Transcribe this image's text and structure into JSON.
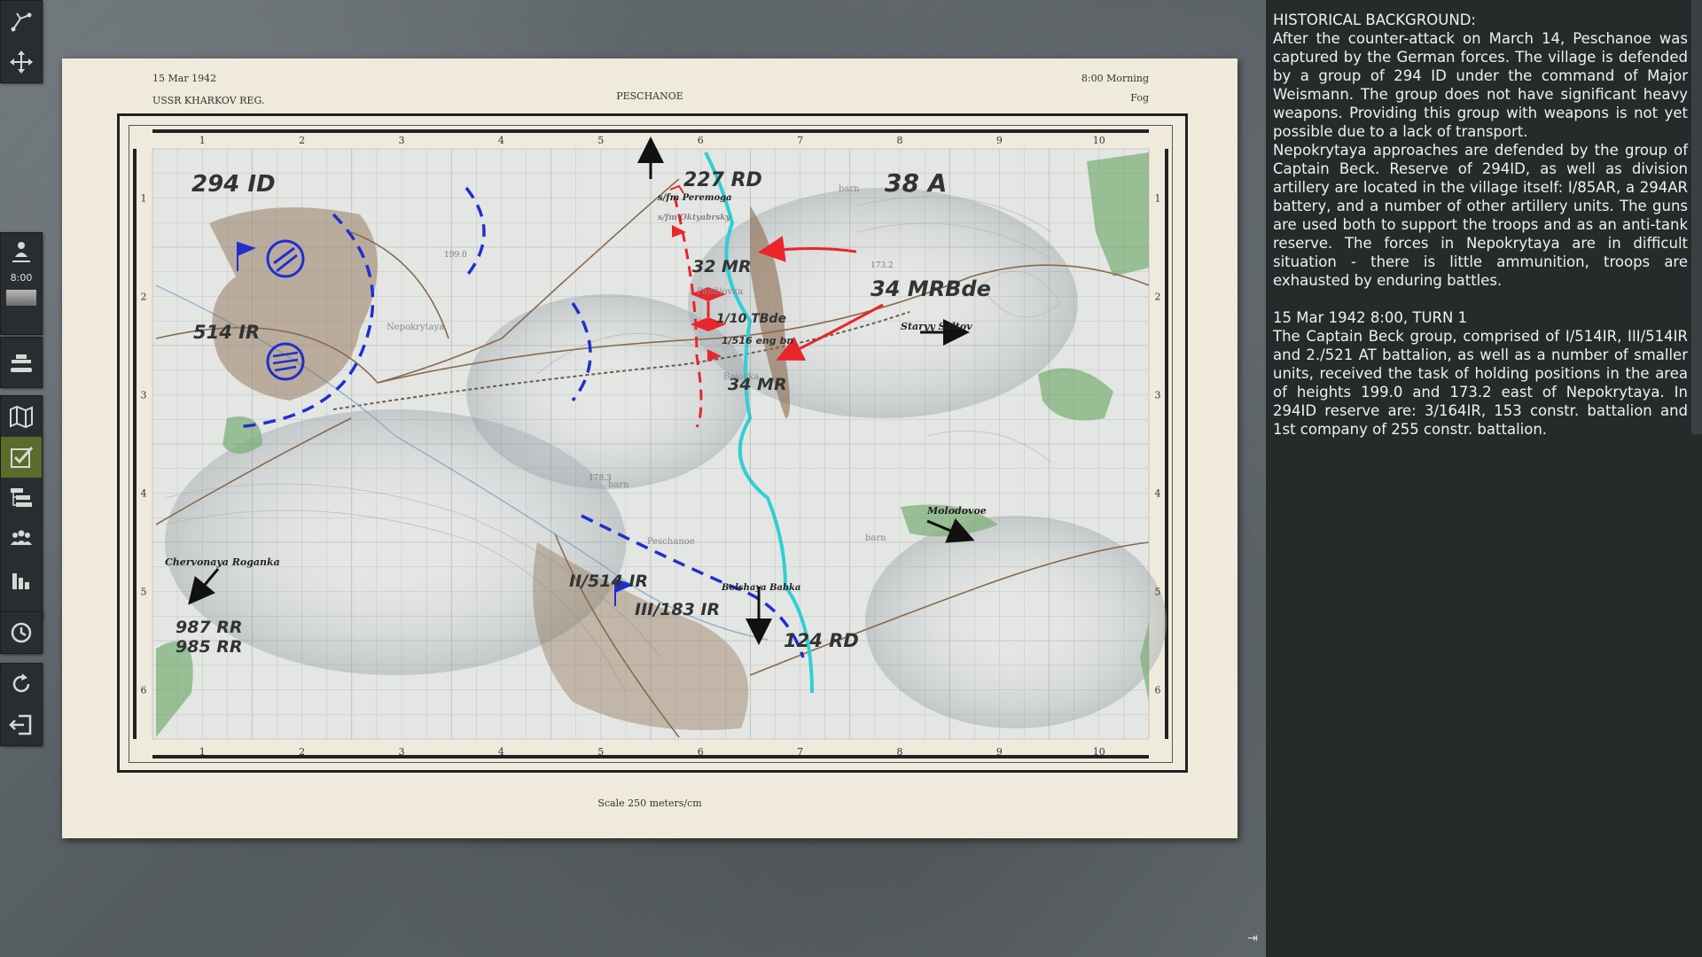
{
  "toolbar": {
    "top_tools": [
      "path-tool-icon",
      "move-icon"
    ],
    "clock_time": "8:00",
    "tools": [
      "unit-icon",
      "tank-icon",
      "map-icon",
      "objectives-icon",
      "orbat-icon",
      "groups-icon",
      "stats-icon",
      "time-icon",
      "restart-icon",
      "exit-icon"
    ]
  },
  "briefing": {
    "date": "15 Mar 1942",
    "region": "USSR KHARKOV REG.",
    "location": "PESCHANOE",
    "time": "8:00 Morning",
    "weather": "Fog",
    "scale": "Scale 250 meters/cm",
    "grid_columns": [
      "1",
      "2",
      "3",
      "4",
      "5",
      "6",
      "7",
      "8",
      "9",
      "10"
    ],
    "grid_rows": [
      "1",
      "2",
      "3",
      "4",
      "5",
      "6"
    ]
  },
  "map_labels": {
    "units": {
      "id294": "294 ID",
      "rd227": "227 RD",
      "a38": "38 A",
      "mr32": "32 MR",
      "mrbde34": "34 MRBde",
      "ir514": "514 IR",
      "tbde110": "1/10 TBde",
      "engbn516": "1/516 eng bn",
      "mr34": "34 MR",
      "ir514_2": "II/514 IR",
      "ir183_3": "III/183 IR",
      "rd124": "124 RD",
      "rr987": "987 RR",
      "rr985": "985 RR"
    },
    "places": {
      "peremoga": "s/fm Peremoga",
      "oktyabrsky": "s/fm Oktyabrsky",
      "staryy_saltov": "Staryy Saltov",
      "molodovoe": "Molodovoe",
      "chervonaya": "Chervonaya Roganka",
      "bolshaya_babka": "Bolshaya Babka",
      "peschanoe": "Peschanoe",
      "nepokrytaya": "Nepokrytaya",
      "panfilovka": "Panfilovka",
      "belovka": "Belovka",
      "barn1": "barn",
      "barn2": "barn",
      "barn3": "barn"
    },
    "heights": {
      "h199": "199.0",
      "h173": "173.2",
      "h1783": "178.3"
    }
  },
  "panel": {
    "heading": "HISTORICAL BACKGROUND:",
    "p1": "After the counter-attack on March 14, Peschanoe was captured by the German forces. The village is defended by a group of 294 ID under the command of Major Weismann. The group does not have significant heavy weapons. Providing this group with weapons is not yet possible due to a lack of transport.",
    "p2": "Nepokrytaya approaches are defended by the group of Captain Beck. Reserve of 294ID, as well as division artillery are located in the village itself: I/85AR, a 294AR battery, and a number of other artillery units. The guns are used both to support the troops and as an anti-tank reserve. The forces in Nepokrytaya are in difficult situation - there is little ammunition, troops are exhausted by enduring battles.",
    "turn": "15 Mar 1942  8:00, TURN 1",
    "p3": "The Captain Beck group, comprised of I/514IR, III/514IR and 2./521 AT battalion, as well as a number of smaller units, received the task of holding positions in the area of heights 199.0 and 173.2 east of Nepokrytaya. In 294ID reserve are: 3/164IR, 153 constr. battalion and 1st company of 255 constr. battalion.",
    "collapse_label": "⇥"
  },
  "colors": {
    "german_blue": "#1f2fd0",
    "soviet_red": "#e8262b",
    "river": "#2ed0d6",
    "forest": "#7fb07a",
    "village": "#8a6a4a"
  }
}
